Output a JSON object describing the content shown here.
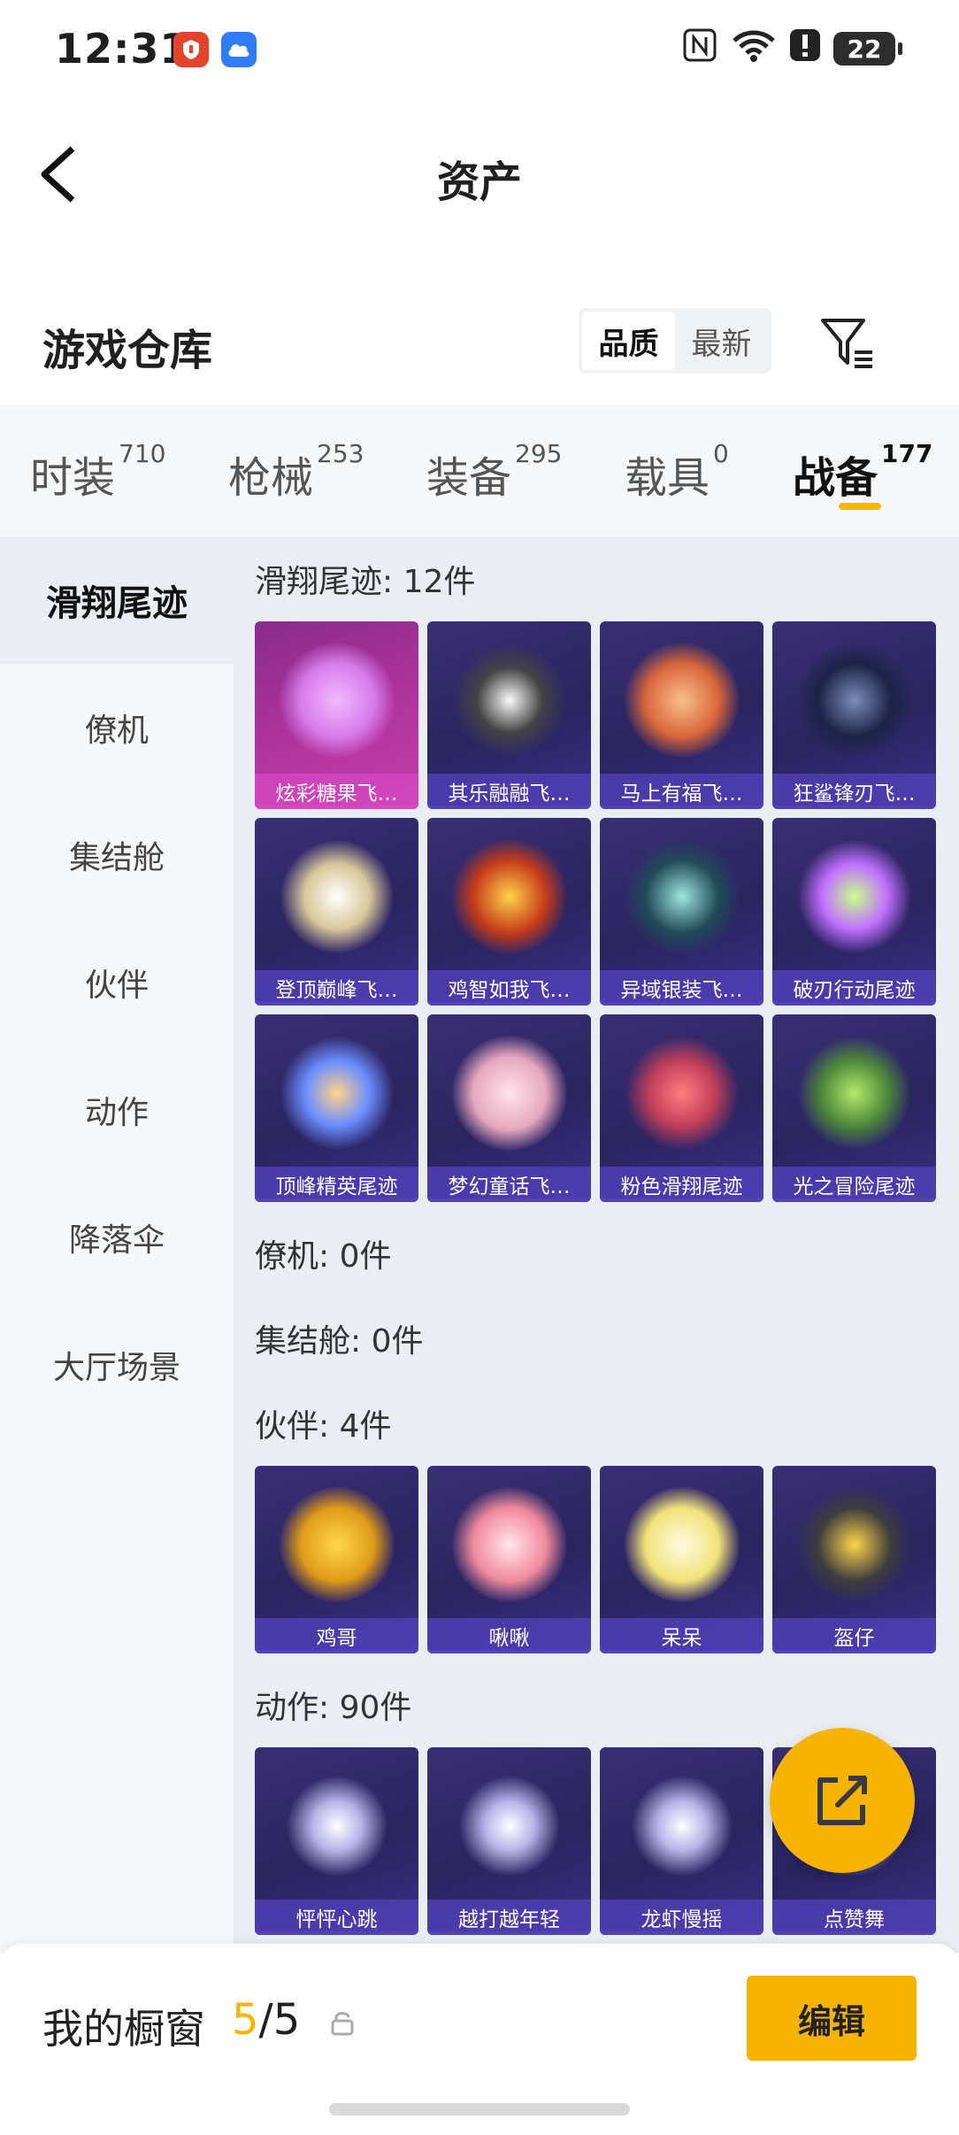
{
  "status_bar": {
    "time": "12:31",
    "battery": "22"
  },
  "header": {
    "title": "资产"
  },
  "warehouse": {
    "title": "游戏仓库",
    "sort_options": [
      "品质",
      "最新"
    ],
    "selected_sort": "品质"
  },
  "tabs": [
    {
      "label": "时装",
      "count": "710"
    },
    {
      "label": "枪械",
      "count": "253"
    },
    {
      "label": "装备",
      "count": "295"
    },
    {
      "label": "载具",
      "count": "0"
    },
    {
      "label": "战备",
      "count": "177"
    }
  ],
  "active_tab": "战备",
  "sidebar": {
    "items": [
      "滑翔尾迹",
      "僚机",
      "集结舱",
      "伙伴",
      "动作",
      "降落伞",
      "大厅场景"
    ],
    "active": "滑翔尾迹"
  },
  "sections": [
    {
      "heading": "滑翔尾迹: 12件",
      "items": [
        "炫彩糖果飞…",
        "其乐融融飞…",
        "马上有福飞…",
        "狂鲨锋刃飞…",
        "登顶巅峰飞…",
        "鸡智如我飞…",
        "异域银装飞…",
        "破刃行动尾迹",
        "顶峰精英尾迹",
        "梦幻童话飞…",
        "粉色滑翔尾迹",
        "光之冒险尾迹"
      ]
    },
    {
      "heading": "僚机: 0件",
      "items": []
    },
    {
      "heading": "集结舱: 0件",
      "items": []
    },
    {
      "heading": "伙伴: 4件",
      "items": [
        "鸡哥",
        "啾啾",
        "呆呆",
        "盔仔"
      ]
    },
    {
      "heading": "动作: 90件",
      "items": [
        "怦怦心跳",
        "越打越年轻",
        "龙虾慢摇",
        "点赞舞"
      ]
    }
  ],
  "bottom_bar": {
    "label": "我的橱窗",
    "current": "5",
    "separator": "/",
    "total": "5",
    "edit_label": "编辑"
  },
  "colors": {
    "accent": "#f6b400",
    "card_purple": "#2b2460",
    "card_pink": "#b4359f"
  }
}
